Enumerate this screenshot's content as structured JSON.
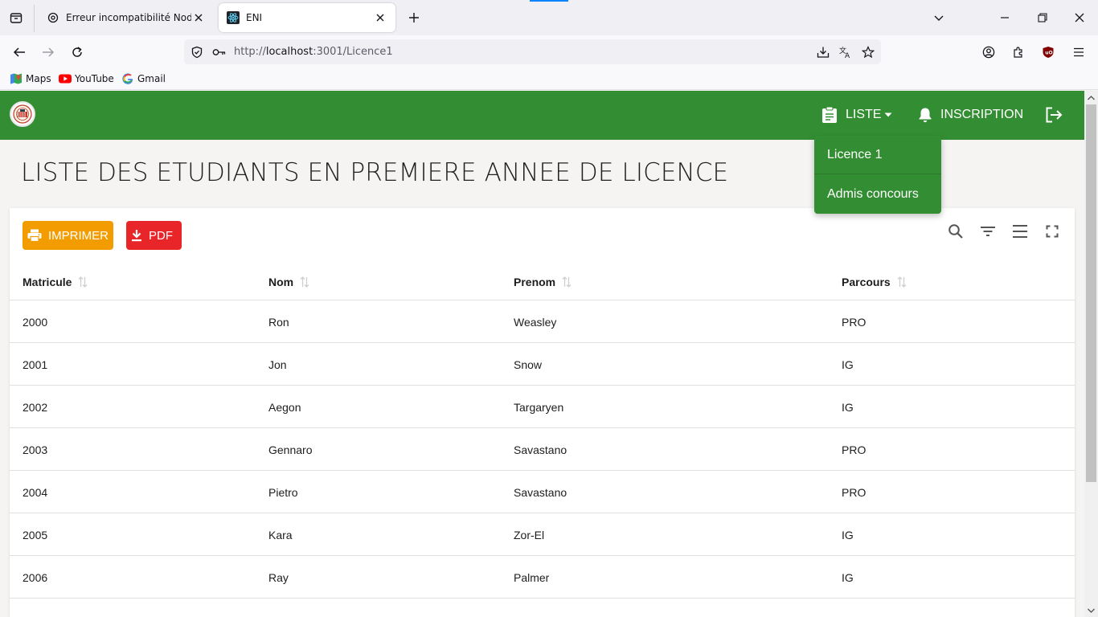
{
  "browser": {
    "tabs": [
      {
        "title": "Erreur incompatibilité Node.js",
        "active": false
      },
      {
        "title": "ENI",
        "active": true
      }
    ],
    "url_scheme": "http://",
    "url_host": "localhost",
    "url_path": ":3001/Licence1",
    "bookmarks": [
      "Maps",
      "YouTube",
      "Gmail"
    ]
  },
  "appbar": {
    "liste_label": "LISTE",
    "inscription_label": "INSCRIPTION",
    "brand_color": "#338e33"
  },
  "dropdown": {
    "items": [
      "Licence 1",
      "Admis concours"
    ]
  },
  "page": {
    "title": "LISTE DES ETUDIANTS EN PREMIERE ANNEE DE LICENCE"
  },
  "toolbar": {
    "print_label": "IMPRIMER",
    "pdf_label": "PDF",
    "print_color": "#f29c00",
    "pdf_color": "#e8262a"
  },
  "table": {
    "columns": [
      "Matricule",
      "Nom",
      "Prenom",
      "Parcours"
    ],
    "rows": [
      [
        "2000",
        "Ron",
        "Weasley",
        "PRO"
      ],
      [
        "2001",
        "Jon",
        "Snow",
        "IG"
      ],
      [
        "2002",
        "Aegon",
        "Targaryen",
        "IG"
      ],
      [
        "2003",
        "Gennaro",
        "Savastano",
        "PRO"
      ],
      [
        "2004",
        "Pietro",
        "Savastano",
        "PRO"
      ],
      [
        "2005",
        "Kara",
        "Zor-El",
        "IG"
      ],
      [
        "2006",
        "Ray",
        "Palmer",
        "IG"
      ]
    ]
  }
}
